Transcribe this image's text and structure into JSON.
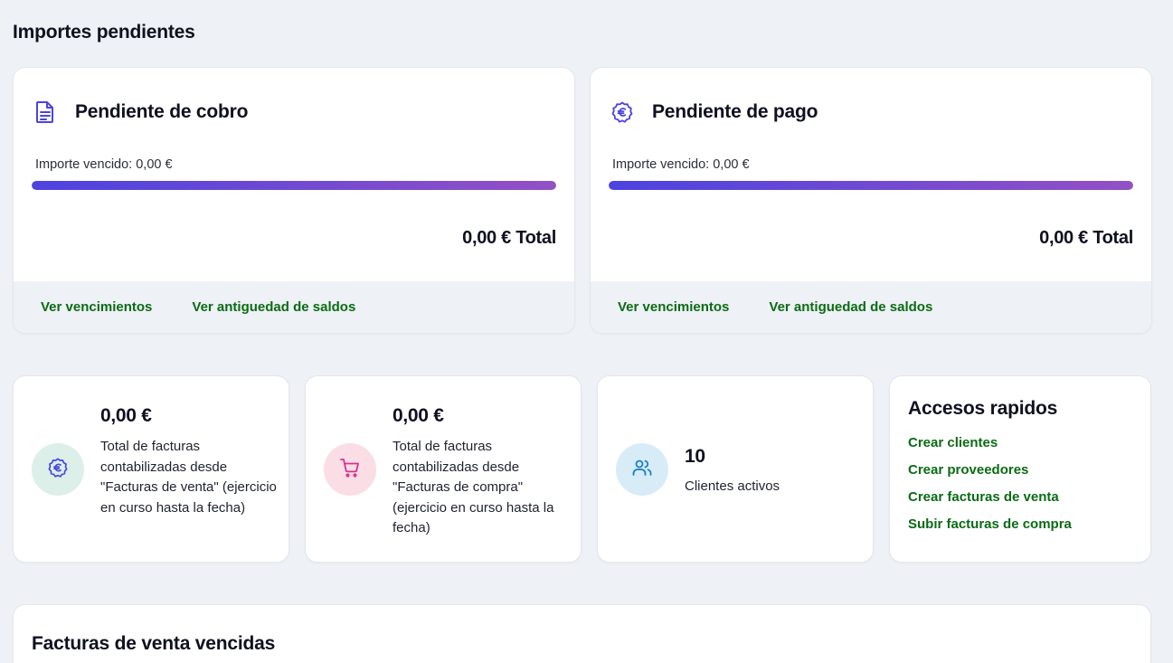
{
  "page": {
    "section_title": "Importes pendientes"
  },
  "cobro": {
    "title": "Pendiente de cobro",
    "icon": "document-icon",
    "vencido": "Importe vencido: 0,00 €",
    "progress": 1.0,
    "total": "0,00 € Total",
    "links": [
      "Ver vencimientos",
      "Ver antiguedad de saldos"
    ]
  },
  "pago": {
    "title": "Pendiente de pago",
    "icon": "euro-badge-icon",
    "vencido": "Importe vencido: 0,00 €",
    "progress": 1.0,
    "total": "0,00 € Total",
    "links": [
      "Ver vencimientos",
      "Ver antiguedad de saldos"
    ]
  },
  "stats": [
    {
      "amount": "0,00 €",
      "description": "Total de facturas contabilizadas desde \"Facturas de venta\" (ejercicio en curso hasta la fecha)",
      "icon": "euro-icon",
      "color": "#dcefe9"
    },
    {
      "amount": "0,00 €",
      "description": "Total de facturas contabilizadas desde \"Facturas de compra\" (ejercicio en curso hasta la fecha)",
      "icon": "cart-icon",
      "color": "#fbdde6"
    },
    {
      "amount": "10",
      "description": "Clientes activos",
      "icon": "users-icon",
      "color": "#d8ecf8"
    }
  ],
  "quick": {
    "title": "Accesos rapidos",
    "links": [
      "Crear clientes",
      "Crear proveedores",
      "Crear facturas de venta",
      "Subir facturas de compra"
    ]
  },
  "overdue": {
    "title": "Facturas de venta vencidas"
  },
  "colors": {
    "accent_link": "#0b6b15",
    "bar_start": "#4c43e0",
    "bar_end": "#9350c5",
    "icon_purple": "#4c43e0"
  }
}
